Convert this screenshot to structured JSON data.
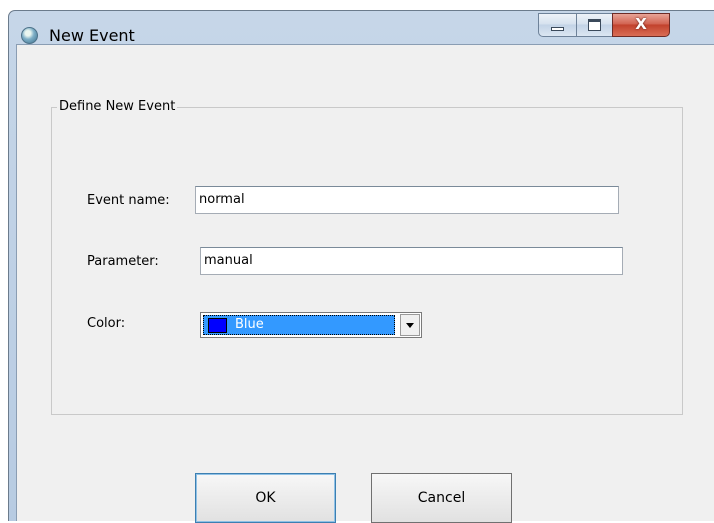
{
  "window": {
    "title": "New Event",
    "app_icon": "globe-icon",
    "caption_buttons": {
      "minimize_icon": "minimize-icon",
      "maximize_icon": "maximize-icon",
      "close_glyph": "X"
    }
  },
  "group": {
    "legend": "Define New Event"
  },
  "fields": {
    "event_name": {
      "label": "Event name:",
      "value": "normal"
    },
    "parameter": {
      "label": "Parameter:",
      "value": "manual"
    },
    "color": {
      "label": "Color:",
      "selected": "Blue",
      "swatch": "#0000ff"
    }
  },
  "buttons": {
    "ok": "OK",
    "cancel": "Cancel"
  },
  "colors": {
    "selection": "#3399ff",
    "titlebar": "#c6d6e8",
    "close": "#c2422d"
  }
}
